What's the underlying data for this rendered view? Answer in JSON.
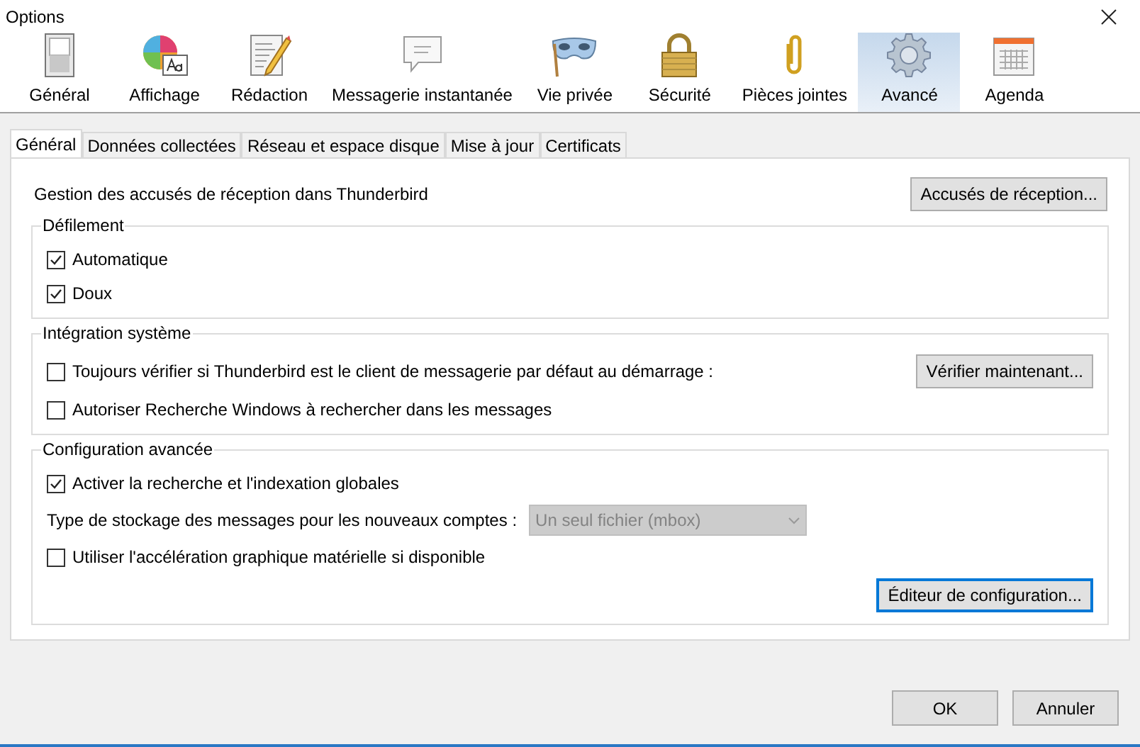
{
  "window": {
    "title": "Options"
  },
  "categories": [
    {
      "label": "Général",
      "selected": false
    },
    {
      "label": "Affichage",
      "selected": false
    },
    {
      "label": "Rédaction",
      "selected": false
    },
    {
      "label": "Messagerie instantanée",
      "selected": false
    },
    {
      "label": "Vie privée",
      "selected": false
    },
    {
      "label": "Sécurité",
      "selected": false
    },
    {
      "label": "Pièces jointes",
      "selected": false
    },
    {
      "label": "Avancé",
      "selected": true
    },
    {
      "label": "Agenda",
      "selected": false
    }
  ],
  "tabs": [
    {
      "label": "Général",
      "selected": true
    },
    {
      "label": "Données collectées",
      "selected": false
    },
    {
      "label": "Réseau et espace disque",
      "selected": false
    },
    {
      "label": "Mise à jour",
      "selected": false
    },
    {
      "label": "Certificats",
      "selected": false
    }
  ],
  "receipts": {
    "label": "Gestion des accusés de réception dans Thunderbird",
    "button": "Accusés de réception..."
  },
  "groups": [
    {
      "title": "Défilement",
      "items": [
        {
          "kind": "checkbox",
          "label": "Automatique",
          "checked": true
        },
        {
          "kind": "checkbox",
          "label": "Doux",
          "checked": true
        }
      ]
    },
    {
      "title": "Intégration système",
      "items": [
        {
          "kind": "checkbox",
          "label": "Toujours vérifier si Thunderbird est le client de messagerie par défaut au démarrage :",
          "checked": false,
          "button": "Vérifier maintenant..."
        },
        {
          "kind": "checkbox",
          "label": "Autoriser Recherche Windows à rechercher dans les messages",
          "checked": false
        }
      ]
    },
    {
      "title": "Configuration avancée",
      "items": [
        {
          "kind": "checkbox",
          "label": "Activer la recherche et l'indexation globales",
          "checked": true
        },
        {
          "kind": "select",
          "label": "Type de stockage des messages pour les nouveaux comptes :",
          "value": "Un seul fichier (mbox)",
          "disabled": true
        },
        {
          "kind": "checkbox",
          "label": "Utiliser l'accélération graphique matérielle si disponible",
          "checked": false
        },
        {
          "kind": "button",
          "label": "Éditeur de configuration...",
          "focused": true
        }
      ]
    }
  ],
  "buttons": [
    {
      "label": "OK"
    },
    {
      "label": "Annuler"
    }
  ]
}
